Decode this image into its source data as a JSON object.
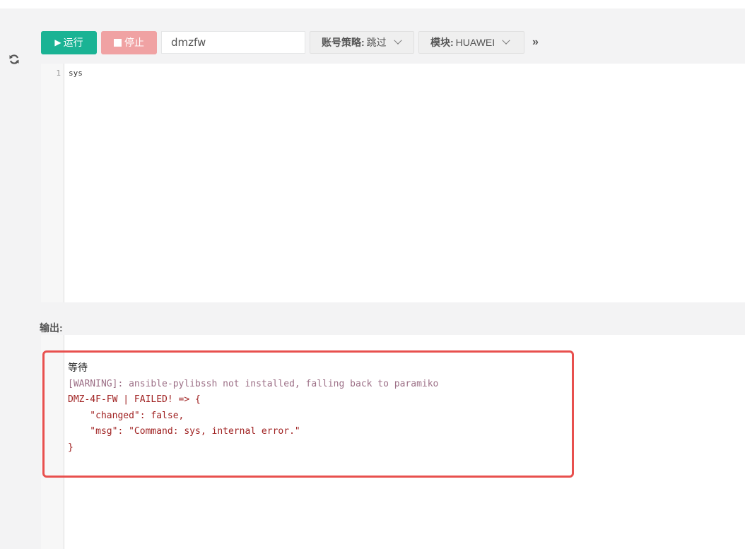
{
  "toolbar": {
    "run_label": "运行",
    "stop_label": "停止",
    "host_value": "dmzfw",
    "account_policy": {
      "label": "账号策略:",
      "value": "跳过"
    },
    "module": {
      "label": "模块:",
      "value": "HUAWEI"
    }
  },
  "editor": {
    "lines": [
      {
        "number": "1",
        "text": "sys"
      }
    ]
  },
  "output": {
    "label": "输出:",
    "status": "等待",
    "warning": "[WARNING]: ansible-pylibssh not installed, falling back to paramiko",
    "error_lines": [
      "DMZ-4F-FW | FAILED! => {",
      "    \"changed\": false,",
      "    \"msg\": \"Command: sys, internal error.\"",
      "}"
    ]
  },
  "colors": {
    "run_button": "#1ab394",
    "stop_button": "#f0a2a3",
    "highlight_border": "#e8504e",
    "warning_text": "#9c6f86",
    "error_text": "#a02222"
  },
  "icons": {
    "refresh": "refresh-icon",
    "run": "play-icon",
    "stop": "stop-icon",
    "more": "double-chevron-right-icon"
  }
}
